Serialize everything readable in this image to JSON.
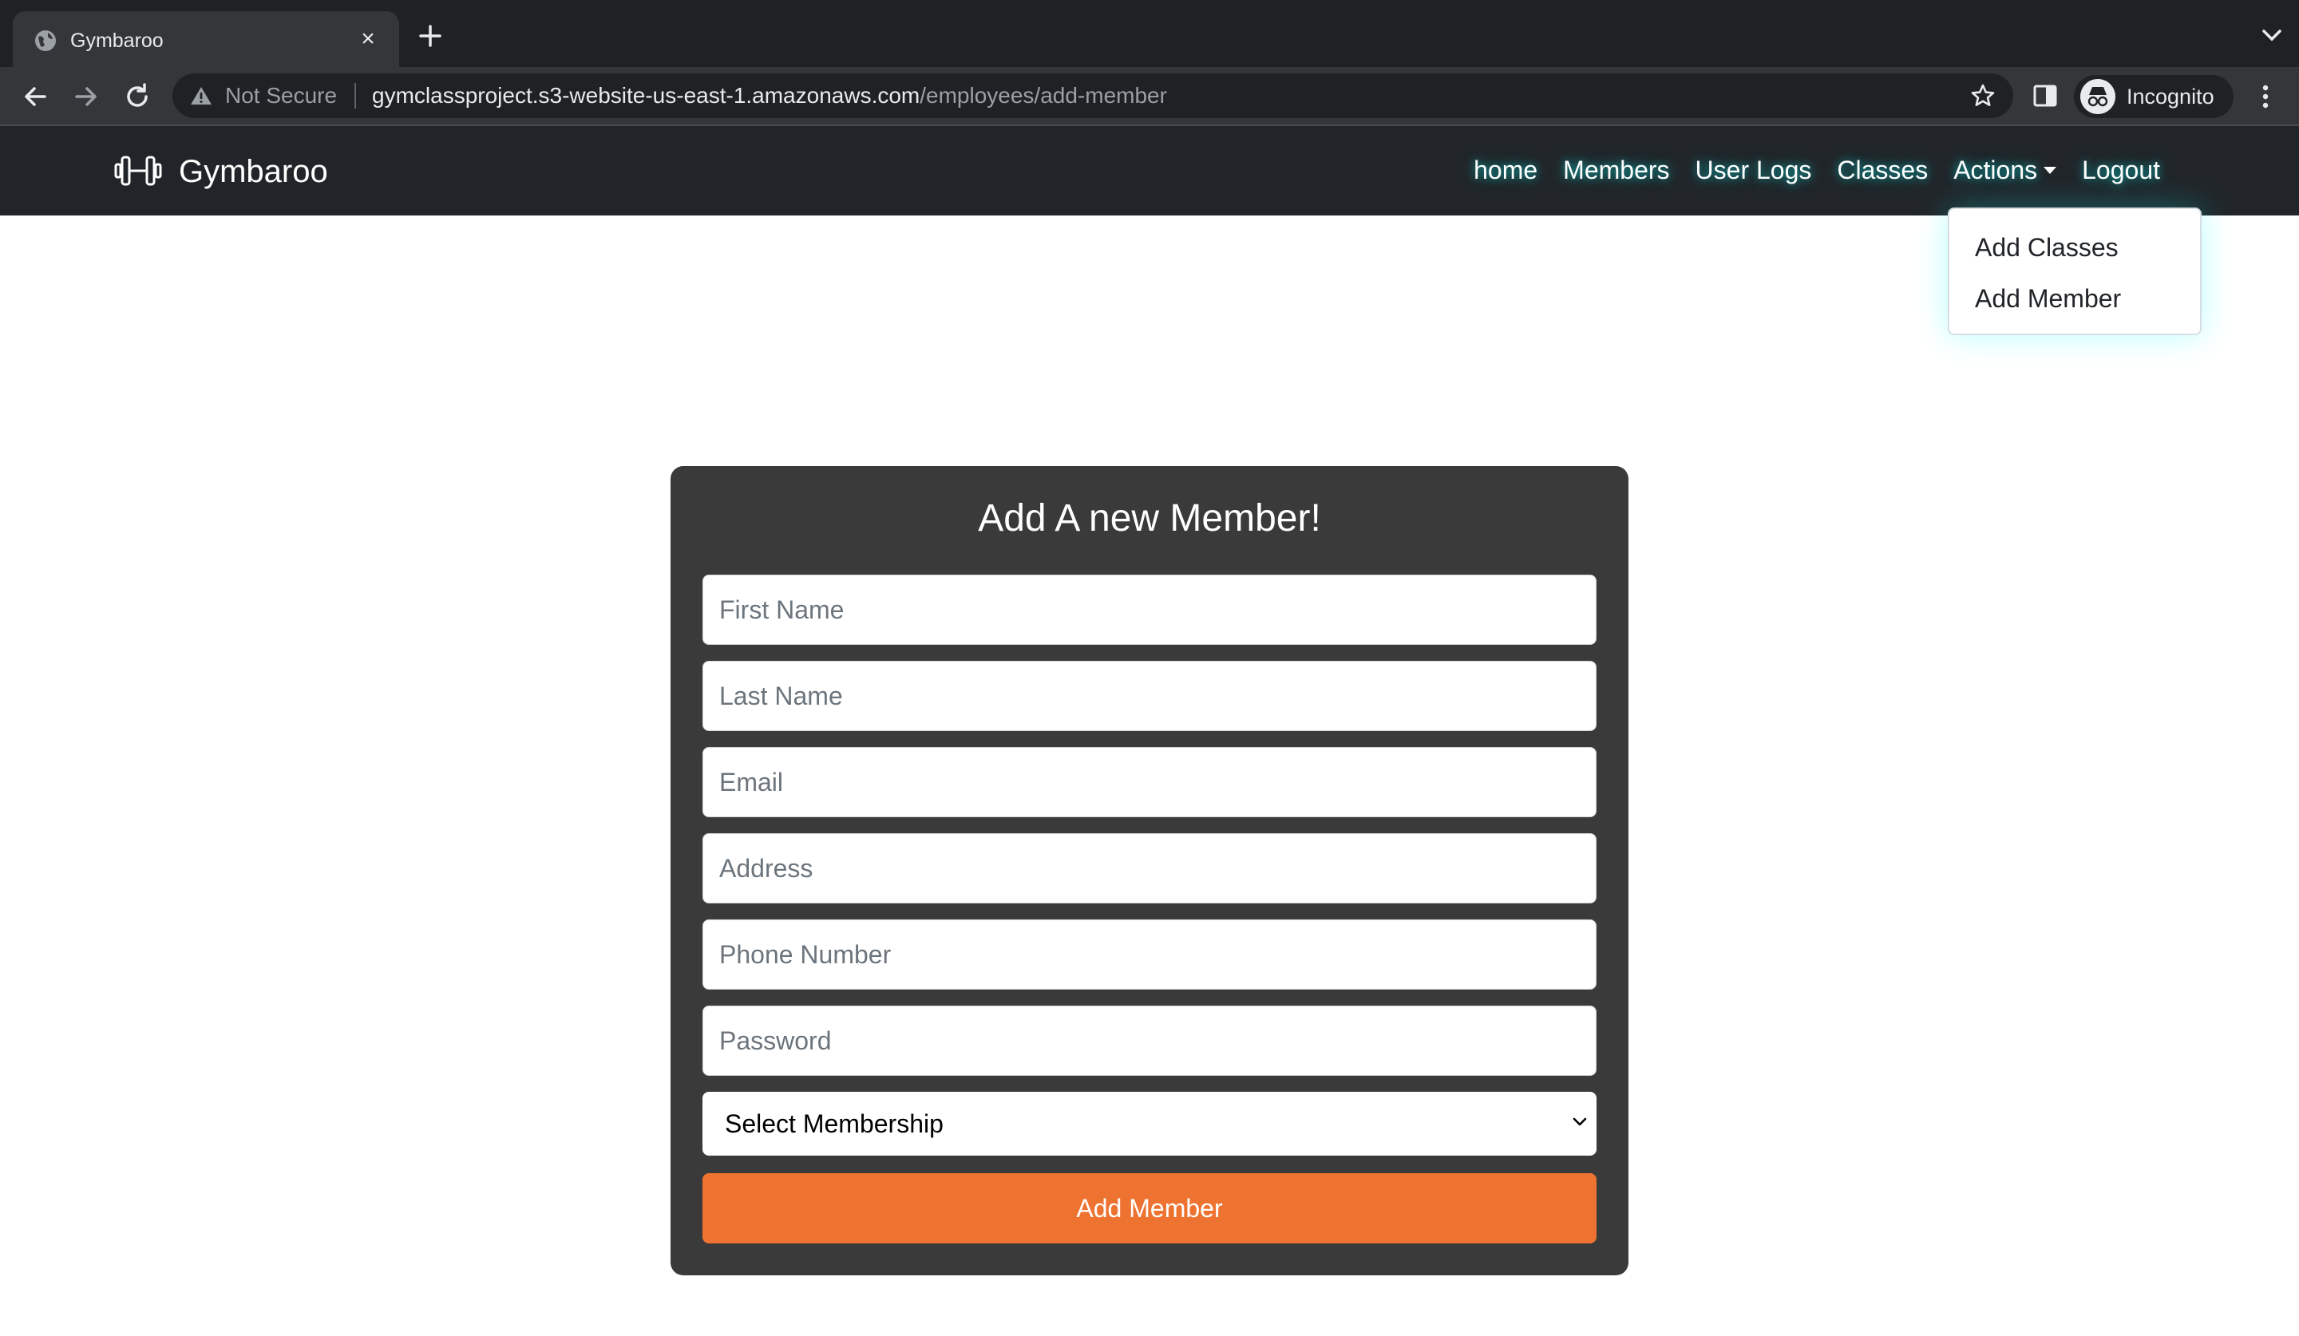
{
  "browser": {
    "tab_title": "Gymbaroo",
    "security_label": "Not Secure",
    "url_host": "gymclassproject.s3-website-us-east-1.amazonaws.com",
    "url_path": "/employees/add-member",
    "profile_label": "Incognito"
  },
  "navbar": {
    "brand": "Gymbaroo",
    "links": [
      "home",
      "Members",
      "User Logs",
      "Classes",
      "Actions",
      "Logout"
    ],
    "dropdown_items": [
      "Add Classes",
      "Add Member"
    ]
  },
  "form": {
    "title": "Add A new Member!",
    "fields": {
      "first_name": "First Name",
      "last_name": "Last Name",
      "email": "Email",
      "address": "Address",
      "phone": "Phone Number",
      "password": "Password"
    },
    "membership_select": "Select Membership",
    "submit_label": "Add Member"
  },
  "colors": {
    "navbar_bg": "#212529",
    "card_bg": "#3a3a3a",
    "accent": "#ee7330"
  }
}
